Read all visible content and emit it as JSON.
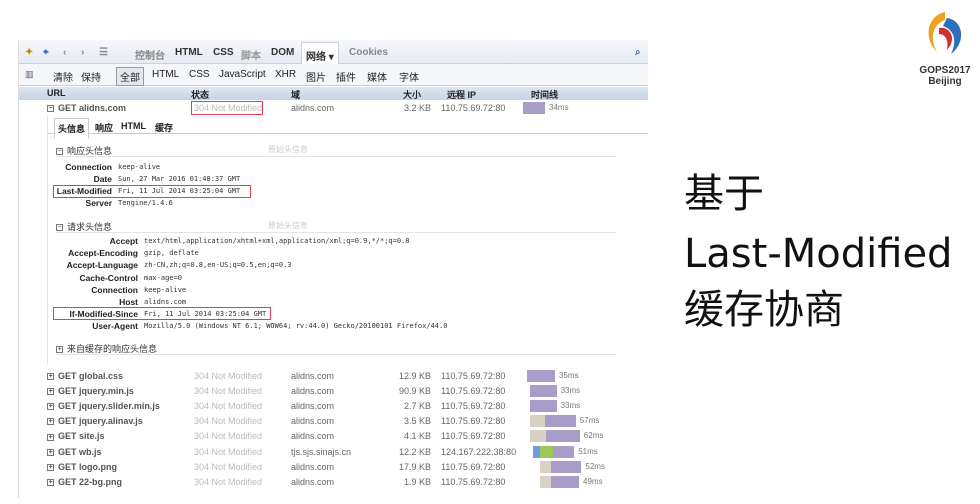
{
  "toolbar": {
    "tabs": [
      "控制台",
      "HTML",
      "CSS",
      "脚本",
      "DOM",
      "网络 ▾",
      "Cookies"
    ],
    "filters": [
      "清除",
      "保持",
      "全部",
      "HTML",
      "CSS",
      "JavaScript",
      "XHR",
      "图片",
      "插件",
      "媒体",
      "字体"
    ]
  },
  "columns": [
    "URL",
    "状态",
    "域",
    "大小",
    "远程 IP",
    "时间线"
  ],
  "main_request": {
    "url": "GET alidns.com",
    "status": "304 Not Modified",
    "domain": "alidns.com",
    "size": "3.2 KB",
    "ip": "110.75.69.72:80",
    "time": "34ms"
  },
  "subtabs": [
    "头信息",
    "响应",
    "HTML",
    "缓存"
  ],
  "response_headers": {
    "title": "响应头信息",
    "raw": "原始头信息",
    "items": [
      {
        "k": "Connection",
        "v": "keep-alive"
      },
      {
        "k": "Date",
        "v": "Sun, 27 Mar 2016 01:48:37 GMT"
      },
      {
        "k": "Last-Modified",
        "v": "Fri, 11 Jul 2014 03:25:04 GMT"
      },
      {
        "k": "Server",
        "v": "Tengine/1.4.6"
      }
    ]
  },
  "request_headers": {
    "title": "请求头信息",
    "raw": "原始头信息",
    "items": [
      {
        "k": "Accept",
        "v": "text/html,application/xhtml+xml,application/xml;q=0.9,*/*;q=0.8"
      },
      {
        "k": "Accept-Encoding",
        "v": "gzip, deflate"
      },
      {
        "k": "Accept-Language",
        "v": "zh-CN,zh;q=0.8,en-US;q=0.5,en;q=0.3"
      },
      {
        "k": "Cache-Control",
        "v": "max-age=0"
      },
      {
        "k": "Connection",
        "v": "keep-alive"
      },
      {
        "k": "Host",
        "v": "alidns.com"
      },
      {
        "k": "If-Modified-Since",
        "v": "Fri, 11 Jul 2014 03:25:04 GMT"
      },
      {
        "k": "User-Agent",
        "v": "Mozilla/5.0 (Windows NT 6.1; WOW64; rv:44.0) Gecko/20100101 Firefox/44.0"
      }
    ]
  },
  "cached_headers": {
    "title": "来自缓存的响应头信息"
  },
  "requests": [
    {
      "url": "GET global.css",
      "status": "304 Not Modified",
      "domain": "alidns.com",
      "size": "12.9 KB",
      "ip": "110.75.69.72:80",
      "time": "35ms"
    },
    {
      "url": "GET jquery.min.js",
      "status": "304 Not Modified",
      "domain": "alidns.com",
      "size": "90.9 KB",
      "ip": "110.75.69.72:80",
      "time": "33ms"
    },
    {
      "url": "GET jquery.slider.min.js",
      "status": "304 Not Modified",
      "domain": "alidns.com",
      "size": "2.7 KB",
      "ip": "110.75.69.72:80",
      "time": "33ms"
    },
    {
      "url": "GET jquery.alinav.js",
      "status": "304 Not Modified",
      "domain": "alidns.com",
      "size": "3.5 KB",
      "ip": "110.75.69.72:80",
      "time": "57ms"
    },
    {
      "url": "GET site.js",
      "status": "304 Not Modified",
      "domain": "alidns.com",
      "size": "4.1 KB",
      "ip": "110.75.69.72:80",
      "time": "62ms"
    },
    {
      "url": "GET wb.js",
      "status": "304 Not Modified",
      "domain": "tjs.sjs.sinajs.cn",
      "size": "12.2 KB",
      "ip": "124.167.222.38:80",
      "time": "51ms"
    },
    {
      "url": "GET logo.png",
      "status": "304 Not Modified",
      "domain": "alidns.com",
      "size": "17.9 KB",
      "ip": "110.75.69.72:80",
      "time": "52ms"
    },
    {
      "url": "GET 22-bg.png",
      "status": "304 Not Modified",
      "domain": "alidns.com",
      "size": "1.9 KB",
      "ip": "110.75.69.72:80",
      "time": "49ms"
    }
  ],
  "timeline_colors": {
    "blocked": "#d8d2c4",
    "dns": "#6aa0d8",
    "connect": "#9cc85a",
    "wait": "#a89cc8"
  },
  "logo": {
    "line1": "GOPS2017",
    "line2": "Beijing"
  },
  "slide": {
    "line1": "基于",
    "line2": "Last-Modified",
    "line3": "缓存协商"
  }
}
